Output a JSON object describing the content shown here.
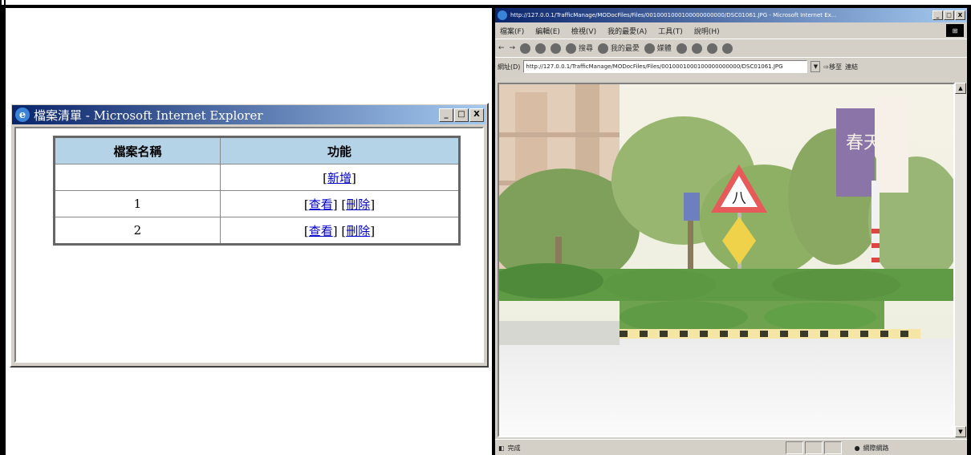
{
  "popup": {
    "title": "檔案清單 - Microsoft Internet Explorer",
    "title_buttons": [
      "_",
      "□",
      "X"
    ],
    "table": {
      "headers": [
        "檔案名稱",
        "功能"
      ],
      "add_row": {
        "name": "",
        "action": "新增"
      },
      "rows": [
        {
          "name": "1",
          "view": "查看",
          "delete": "刪除"
        },
        {
          "name": "2",
          "view": "查看",
          "delete": "刪除"
        }
      ]
    }
  },
  "viewer": {
    "title": "http://127.0.0.1/TrafficManage/MODocFiles/Files/0010001000100000000000/DSC01061.JPG - Microsoft Internet Ex...",
    "menu": [
      "檔案(F)",
      "編輯(E)",
      "檢視(V)",
      "我的最愛(A)",
      "工具(T)",
      "說明(H)"
    ],
    "toolbar": {
      "search": "搜尋",
      "favorites": "我的最愛",
      "media": "媒體"
    },
    "address_label": "網址(D)",
    "address": "http://127.0.0.1/TrafficManage/MODocFiles/Files/0010001000100000000000/DSC01061.JPG",
    "go_label": "移至",
    "links_label": "連結",
    "status": {
      "left": "完成",
      "zone": "網際網路"
    },
    "sign_text": "八",
    "banner_text": "春天"
  }
}
